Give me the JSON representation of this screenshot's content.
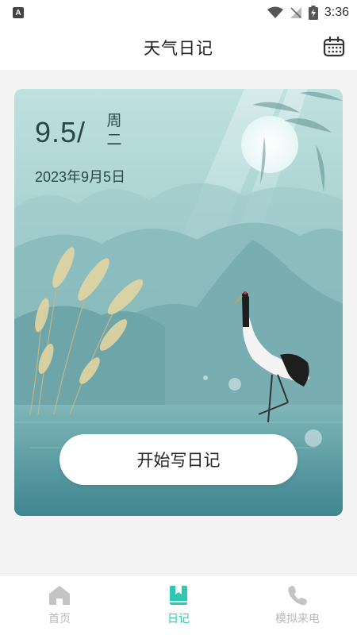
{
  "status_bar": {
    "time": "3:36",
    "app_icon_letter": "A"
  },
  "header": {
    "title": "天气日记"
  },
  "card": {
    "date_short": "9.5/",
    "weekday_chars": [
      "周",
      "二"
    ],
    "date_full": "2023年9月5日",
    "write_button_label": "开始写日记"
  },
  "bottom_nav": {
    "items": [
      {
        "label": "首页",
        "icon": "home-icon",
        "active": false
      },
      {
        "label": "日记",
        "icon": "diary-bookmark-icon",
        "active": true
      },
      {
        "label": "模拟来电",
        "icon": "phone-icon",
        "active": false
      }
    ]
  },
  "colors": {
    "accent": "#2dc7b2",
    "inactive": "#b9b9b9",
    "text_dark": "#2c4548"
  }
}
